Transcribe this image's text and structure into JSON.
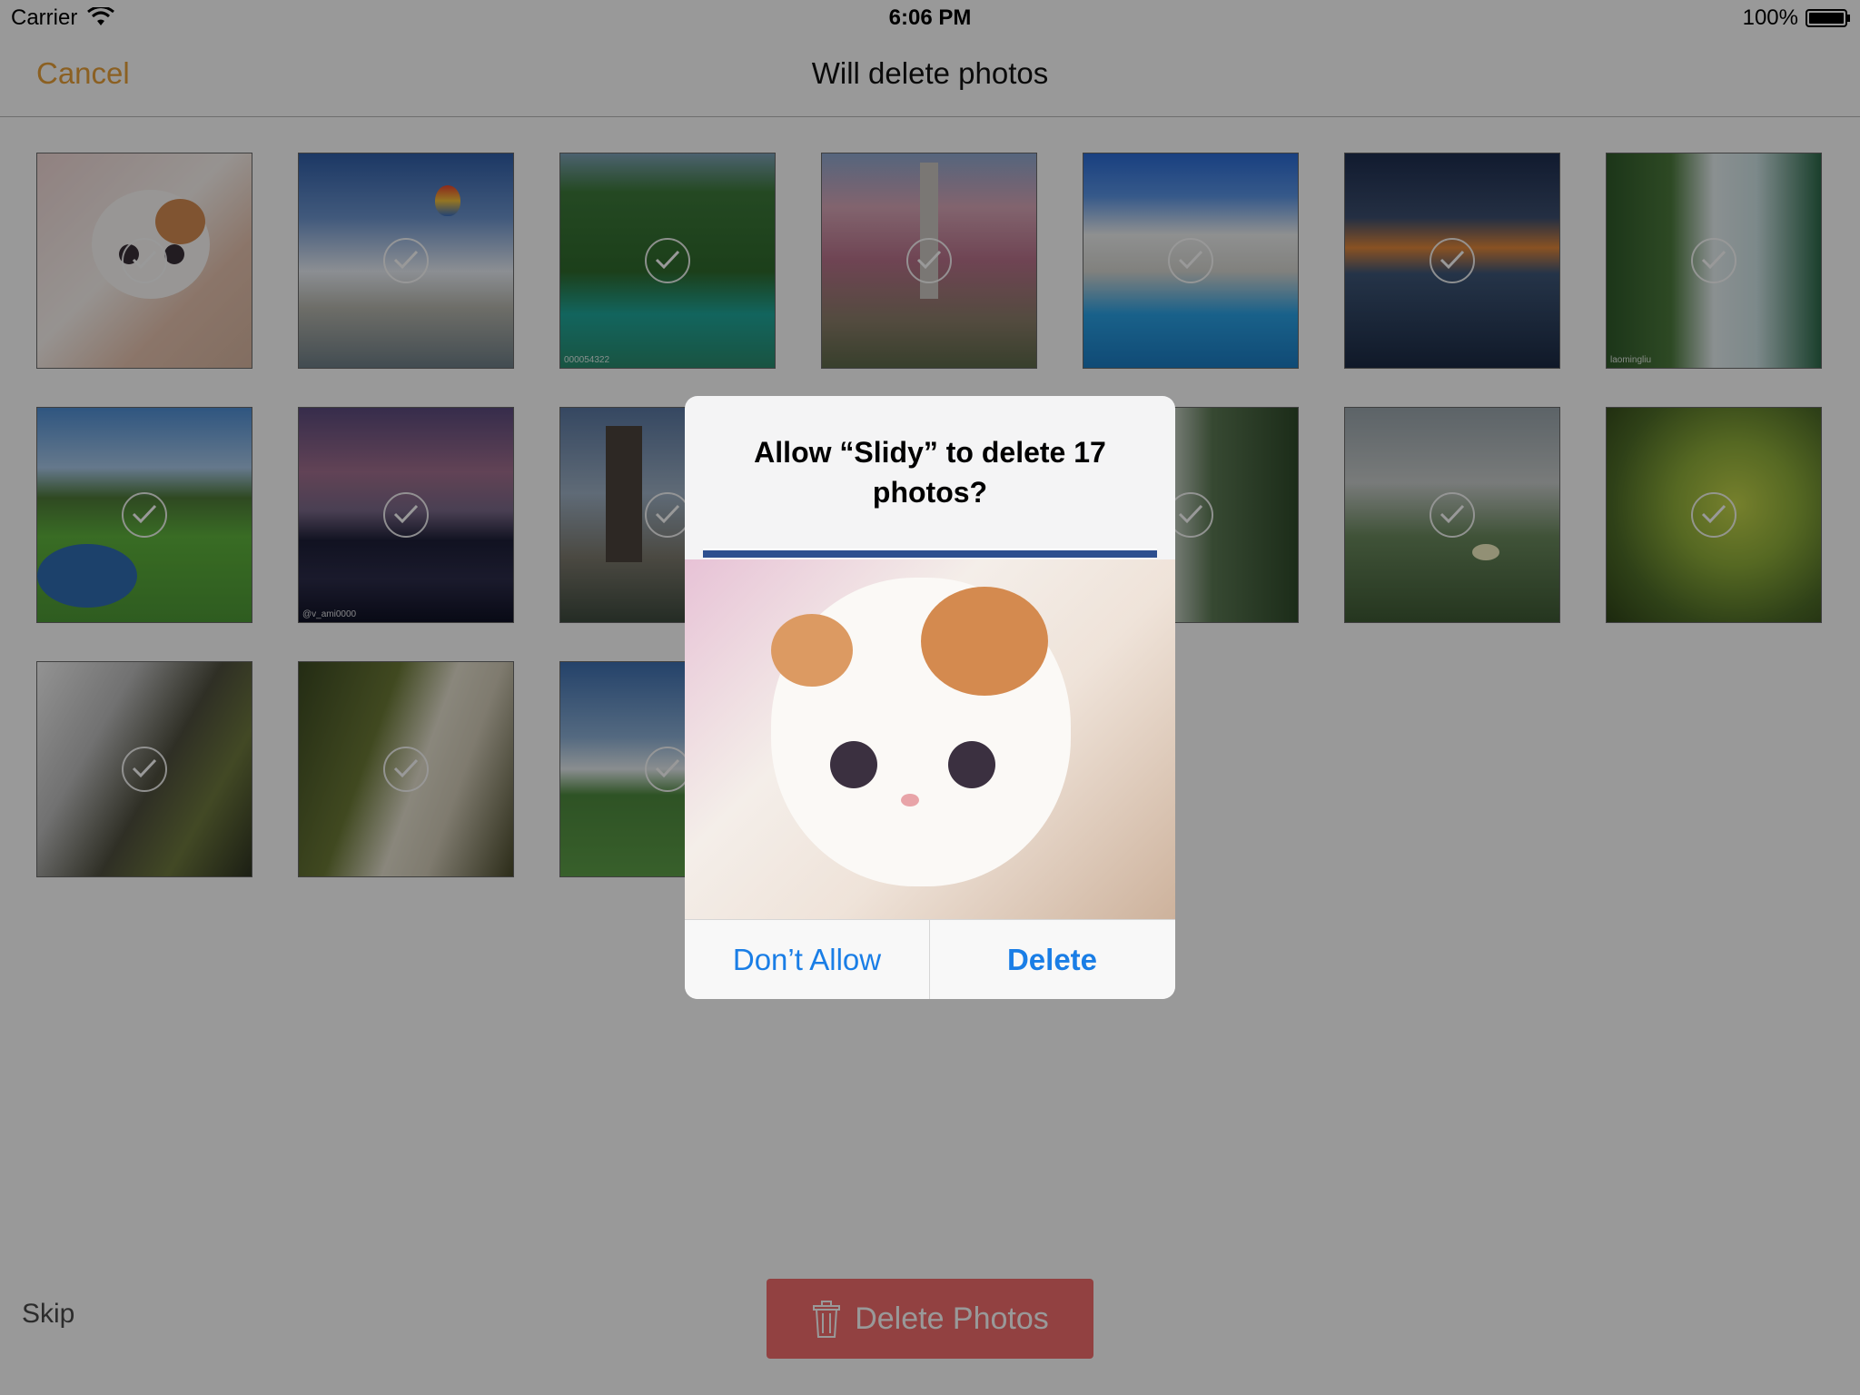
{
  "status_bar": {
    "carrier": "Carrier",
    "time": "6:06 PM",
    "battery": "100%"
  },
  "nav": {
    "cancel_label": "Cancel",
    "title": "Will delete photos"
  },
  "photos": [
    {
      "name": "cat",
      "caption": ""
    },
    {
      "name": "balloon-city",
      "caption": ""
    },
    {
      "name": "green-river",
      "caption": "000054322"
    },
    {
      "name": "blossom-fountain",
      "caption": ""
    },
    {
      "name": "pool-villa",
      "caption": ""
    },
    {
      "name": "sunset-shore",
      "caption": ""
    },
    {
      "name": "waterfall-cliff",
      "caption": "laomingliu"
    },
    {
      "name": "golf-pond",
      "caption": ""
    },
    {
      "name": "dusk-mountains",
      "caption": "@v_ami0000"
    },
    {
      "name": "pagoda",
      "caption": ""
    },
    {
      "name": "hidden-waterfall",
      "caption": ""
    },
    {
      "name": "grass-flower",
      "caption": ""
    },
    {
      "name": "leaves",
      "caption": ""
    },
    {
      "name": "bw-waterfall",
      "caption": ""
    },
    {
      "name": "mossy-waterfall",
      "caption": ""
    },
    {
      "name": "grassland-riders",
      "caption": ""
    }
  ],
  "bottom": {
    "skip_label": "Skip",
    "delete_label": "Delete Photos"
  },
  "alert": {
    "title": "Allow “Slidy” to delete 17 photos?",
    "deny_label": "Don’t Allow",
    "confirm_label": "Delete"
  },
  "colors": {
    "accent": "#e8a03a",
    "delete_button": "#f36d6d",
    "alert_link": "#1a7ee6"
  }
}
